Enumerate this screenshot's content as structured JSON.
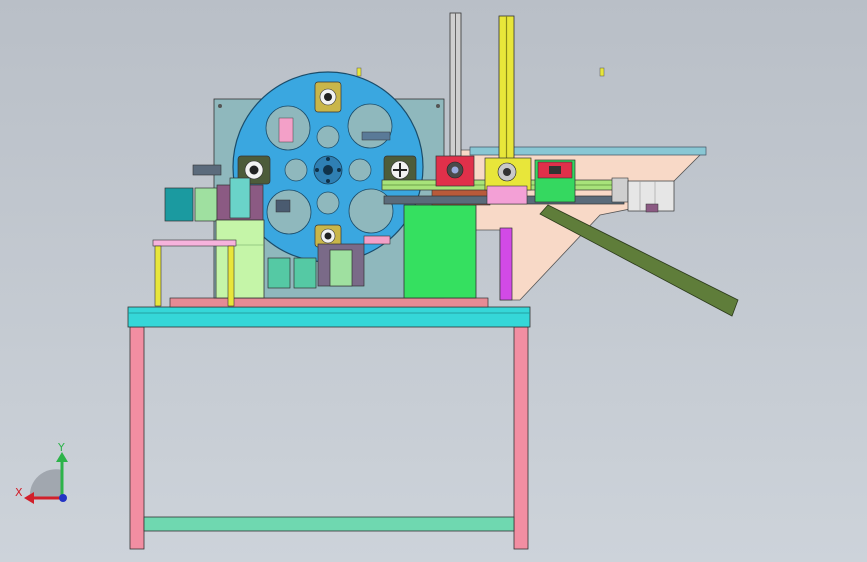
{
  "triad": {
    "x_label": "X",
    "y_label": "Y",
    "x_color": "#d11f2a",
    "y_color": "#2db34a",
    "z_color": "#2233c4"
  },
  "palette": {
    "background": "#c4cad1",
    "disc": "#3aa7e0",
    "table_top": "#35d7d8",
    "legs": "#f28ea2",
    "crossbar": "#6fd8b0",
    "back_plate": "#8fb8bd",
    "hopper": "#f8d9c7",
    "chute": "#5f7d3a",
    "rail_yellow": "#e8e63a",
    "green_block": "#35e060",
    "magenta": "#d24ae6"
  },
  "parts": [
    "frame-table",
    "rotary-index-disc",
    "vertical-feed-rails",
    "horizontal-slide-assembly",
    "feed-hopper",
    "discharge-chute",
    "stepper-motor",
    "left-cylinder-group"
  ]
}
